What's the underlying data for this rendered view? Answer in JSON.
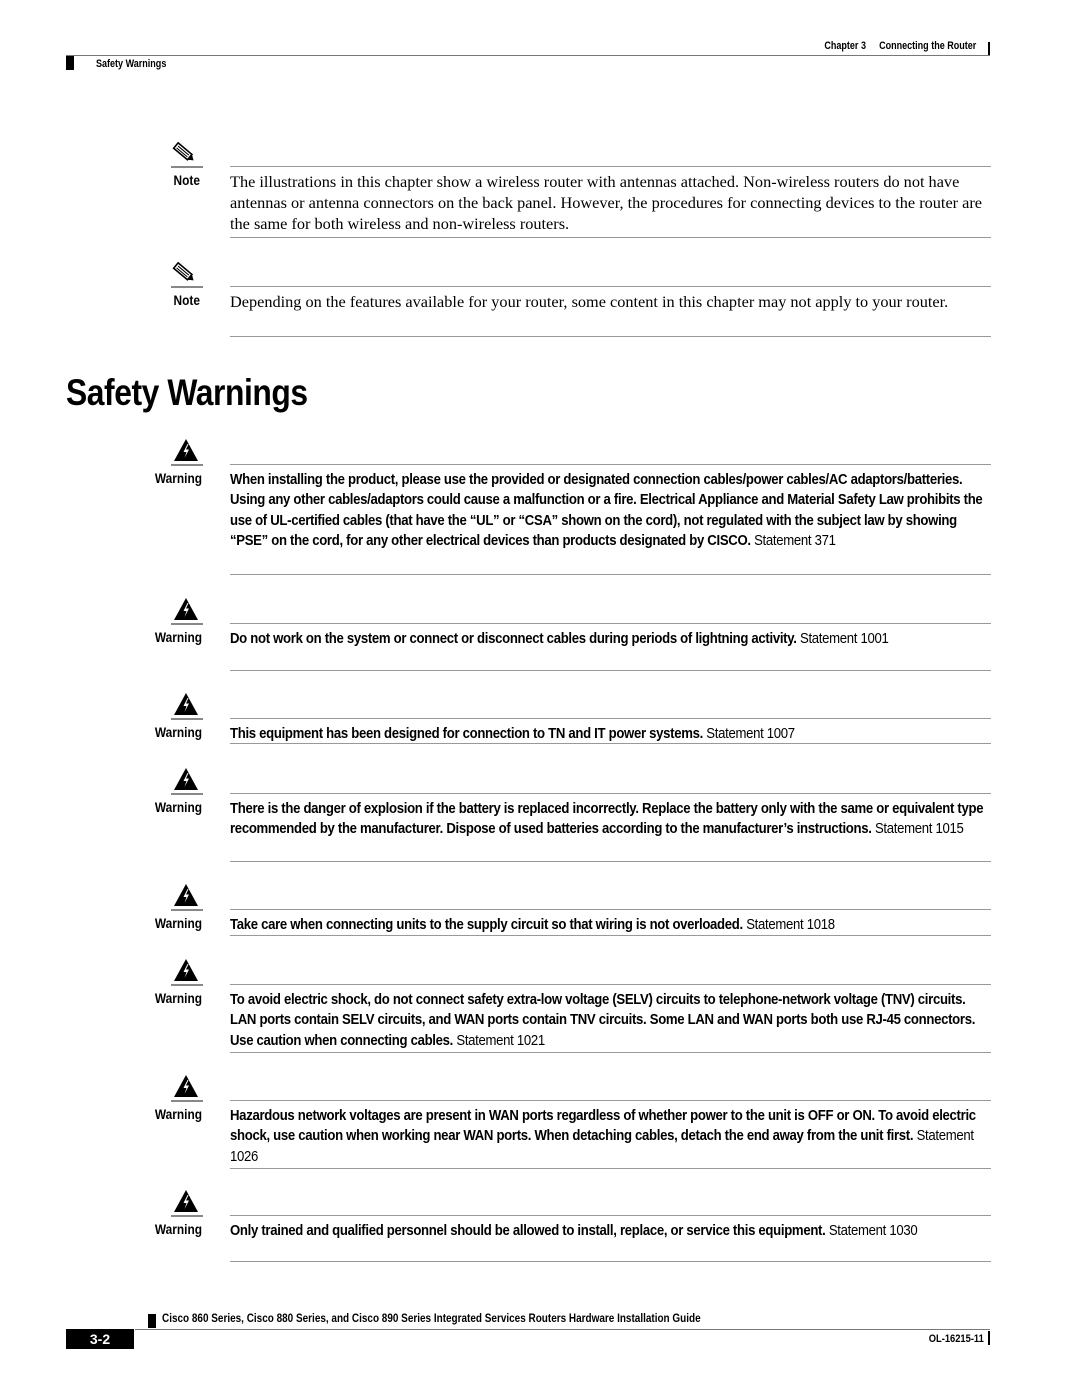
{
  "header": {
    "chapter_label": "Chapter 3",
    "chapter_title": "Connecting the Router",
    "section": "Safety Warnings"
  },
  "notes": [
    {
      "label": "Note",
      "icon": "pencil-note-icon",
      "text": "The illustrations in this chapter show a wireless router with antennas attached. Non-wireless routers do not have antennas or antenna connectors on the back panel. However, the procedures for connecting devices to the router are the same for both wireless and non-wireless routers."
    },
    {
      "label": "Note",
      "icon": "pencil-note-icon",
      "text": "Depending on the features available for your router, some content in this chapter may not apply to your router."
    }
  ],
  "section_title": "Safety Warnings",
  "warnings": [
    {
      "label": "Warning",
      "icon": "warning-lightning-icon",
      "text": "When installing the product, please use the provided or designated connection cables/power cables/AC adaptors/batteries. Using any other cables/adaptors could cause a malfunction or a fire. Electrical Appliance and Material Safety Law prohibits the use of UL-certified cables (that have the “UL” or “CSA” shown on the cord), not regulated with the subject law by showing “PSE” on the cord, for any other electrical devices than products designated by CISCO.",
      "statement": "Statement 371"
    },
    {
      "label": "Warning",
      "icon": "warning-lightning-icon",
      "text": "Do not work on the system or connect or disconnect cables during periods of lightning activity.",
      "statement": "Statement 1001"
    },
    {
      "label": "Warning",
      "icon": "warning-lightning-icon",
      "text": "This equipment has been designed for connection to TN and IT power systems.",
      "statement": "Statement 1007"
    },
    {
      "label": "Warning",
      "icon": "warning-lightning-icon",
      "text": "There is the danger of explosion if the battery is replaced incorrectly. Replace the battery only with the same or equivalent type recommended by the manufacturer. Dispose of used batteries according to the manufacturer’s instructions.",
      "statement": "Statement 1015"
    },
    {
      "label": "Warning",
      "icon": "warning-lightning-icon",
      "text": "Take care when connecting units to the supply circuit so that wiring is not overloaded.",
      "statement": "Statement 1018"
    },
    {
      "label": "Warning",
      "icon": "warning-lightning-icon",
      "text": "To avoid electric shock, do not connect safety extra-low voltage (SELV) circuits to telephone-network voltage (TNV) circuits. LAN ports contain SELV circuits, and WAN ports contain TNV circuits. Some LAN and WAN ports both use RJ-45 connectors. Use caution when connecting cables.",
      "statement": "Statement 1021"
    },
    {
      "label": "Warning",
      "icon": "warning-lightning-icon",
      "text": "Hazardous network voltages are present in WAN ports regardless of whether power to the unit is OFF or ON. To avoid electric shock, use caution when working near WAN ports. When detaching cables, detach the end away from the unit first.",
      "statement": "Statement 1026"
    },
    {
      "label": "Warning",
      "icon": "warning-lightning-icon",
      "text": "Only trained and qualified personnel should be allowed to install, replace, or service this equipment.",
      "statement": "Statement 1030"
    }
  ],
  "footer": {
    "guide_title": "Cisco 860 Series, Cisco 880 Series, and Cisco 890 Series Integrated Services Routers Hardware Installation Guide",
    "page_number": "3-2",
    "doc_number": "OL-16215-11"
  }
}
